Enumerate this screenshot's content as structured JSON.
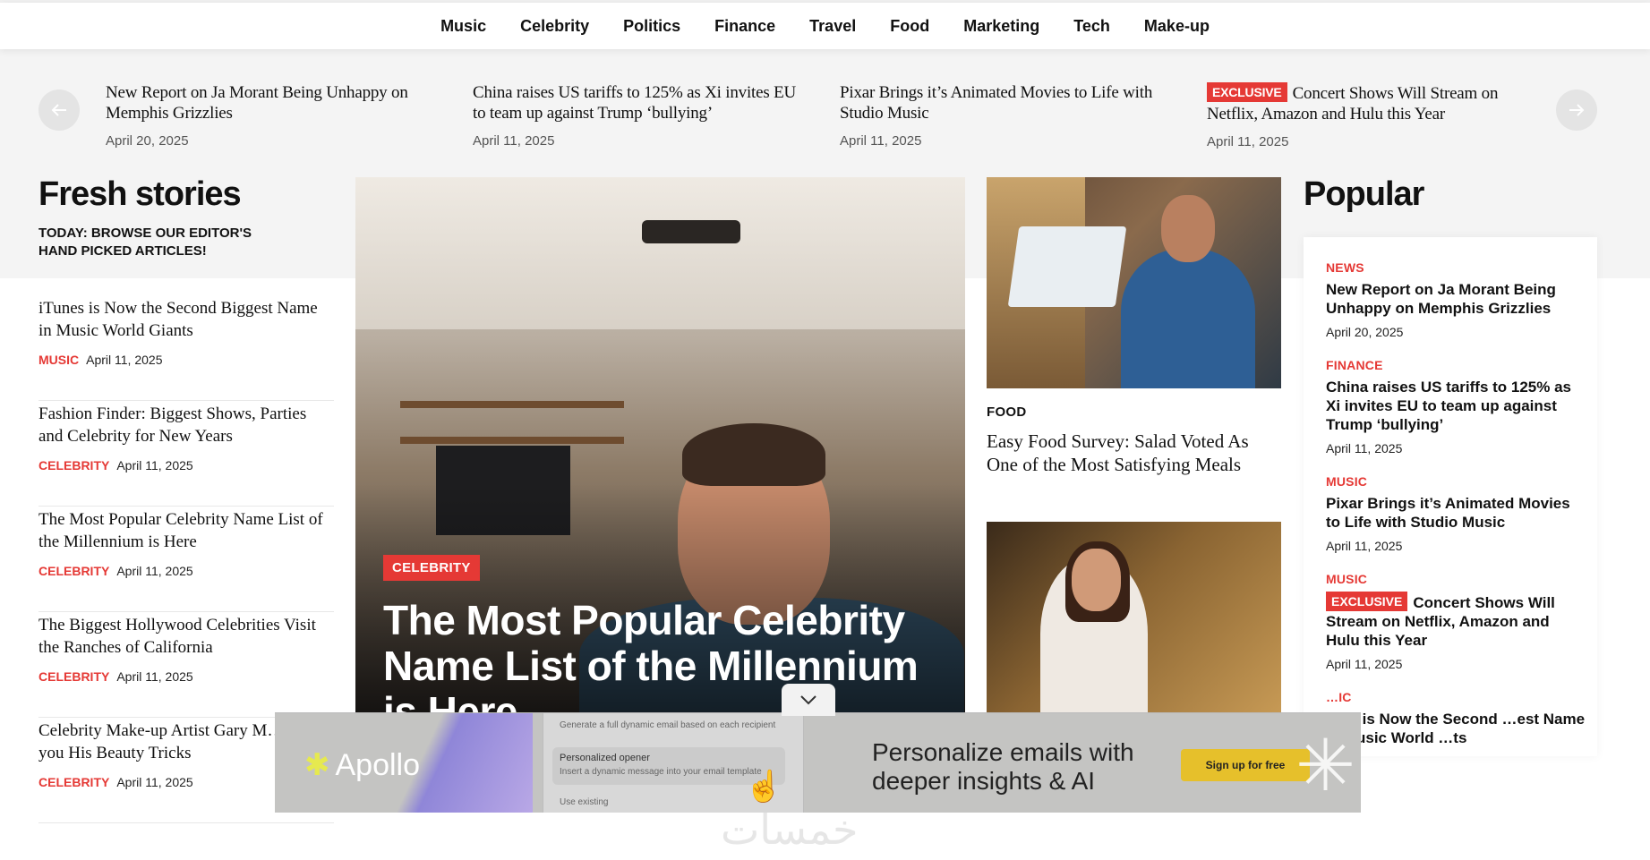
{
  "nav": {
    "items": [
      "Music",
      "Celebrity",
      "Politics",
      "Finance",
      "Travel",
      "Food",
      "Marketing",
      "Tech",
      "Make-up"
    ]
  },
  "ticker": {
    "left_arrow_icon": "arrow-left-icon",
    "right_arrow_icon": "arrow-right-icon",
    "items": [
      {
        "badge": "",
        "title": "New Report on Ja Morant Being Unhappy on Memphis Grizzlies",
        "date": "April 20, 2025"
      },
      {
        "badge": "",
        "title": "China raises US tariffs to 125% as Xi invites EU to team up against Trump ‘bullying’",
        "date": "April 11, 2025"
      },
      {
        "badge": "",
        "title": "Pixar Brings it’s Animated Movies to Life with Studio Music",
        "date": "April 11, 2025"
      },
      {
        "badge": "EXCLUSIVE",
        "title": "Concert Shows Will Stream on Netflix, Amazon and Hulu this Year",
        "date": "April 11, 2025"
      }
    ]
  },
  "fresh": {
    "title": "Fresh stories",
    "subtitle": "TODAY: BROWSE OUR EDITOR'S HAND PICKED ARTICLES!",
    "items": [
      {
        "title": "iTunes is Now the Second Biggest Name in Music World Giants",
        "category": "MUSIC",
        "date": "April 11, 2025"
      },
      {
        "title": "Fashion Finder: Biggest Shows, Parties and Celebrity for New Years",
        "category": "CELEBRITY",
        "date": "April 11, 2025"
      },
      {
        "title": "The Most Popular Celebrity Name List of the Millennium is Here",
        "category": "CELEBRITY",
        "date": "April 11, 2025"
      },
      {
        "title": "The Biggest Hollywood Celebrities Visit the Ranches of California",
        "category": "CELEBRITY",
        "date": "April 11, 2025"
      },
      {
        "title": "Celebrity Make-up Artist Gary M… Shows you His Beauty Tricks",
        "category": "CELEBRITY",
        "date": "April 11, 2025"
      }
    ]
  },
  "hero": {
    "category": "CELEBRITY",
    "title": "The Most Popular Celebrity Name List of the Millennium is Here"
  },
  "side_card": {
    "category": "FOOD",
    "title": "Easy Food Survey: Salad Voted As One of the Most Satisfying Meals"
  },
  "popular": {
    "title": "Popular",
    "items": [
      {
        "category": "NEWS",
        "badge": "",
        "title": "New Report on Ja Morant Being Unhappy on Memphis Grizzlies",
        "date": "April 20, 2025"
      },
      {
        "category": "FINANCE",
        "badge": "",
        "title": "China raises US tariffs to 125% as Xi invites EU to team up against Trump ‘bullying’",
        "date": "April 11, 2025"
      },
      {
        "category": "MUSIC",
        "badge": "",
        "title": "Pixar Brings it’s Animated Movies to Life with Studio Music",
        "date": "April 11, 2025"
      },
      {
        "category": "MUSIC",
        "badge": "EXCLUSIVE",
        "title": "Concert Shows Will Stream on Netflix, Amazon and Hulu this Year",
        "date": "April 11, 2025"
      },
      {
        "category": "…IC",
        "badge": "",
        "title": "…es is Now the Second …est Name in Music World …ts",
        "date": ""
      }
    ]
  },
  "ad": {
    "brand": "Apollo",
    "shot_rows": [
      "Generate a full dynamic email based on each recipient",
      "Personalized opener",
      "Insert a dynamic message into your email template",
      "Use existing"
    ],
    "headline": "Personalize emails with deeper insights & AI",
    "cta": "Sign up for free",
    "collapse_icon": "chevron-down-icon"
  },
  "watermark": "خمسات",
  "colors": {
    "accent": "#e53935",
    "band": "#f4f4f4",
    "cta": "#e6c02b"
  }
}
